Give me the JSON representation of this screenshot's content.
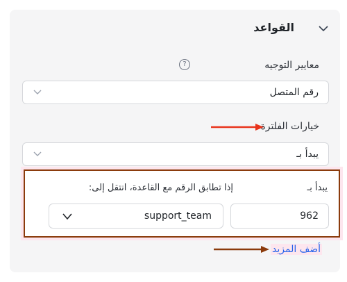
{
  "rules_section": {
    "title": "القواعد",
    "routing_criteria_label": "معايير التوجيه",
    "help_symbol": "?",
    "routing_criteria_value": "رقم المتصل",
    "filter_options_label": "خيارات الفلترة",
    "filter_option_value": "يبدأ بـ",
    "rule_row": {
      "starts_with_label": "يبدأ بـ",
      "starts_with_value": "962",
      "go_to_label": "إذا تطابق الرقم مع القاعدة، انتقل إلى:",
      "go_to_value": "support_team"
    },
    "add_more_label": "أضف المزيد"
  },
  "colors": {
    "arrow_red": "#e8341c",
    "arrow_brown": "#8b3b0c",
    "highlight_border": "#8b3b0c",
    "link_blue": "#2563eb",
    "highlight_pink": "#fde6ee"
  },
  "icons": {
    "section_toggle": "chevron-down-icon",
    "help": "question-circle-icon",
    "select_caret": "chevron-down-icon"
  }
}
